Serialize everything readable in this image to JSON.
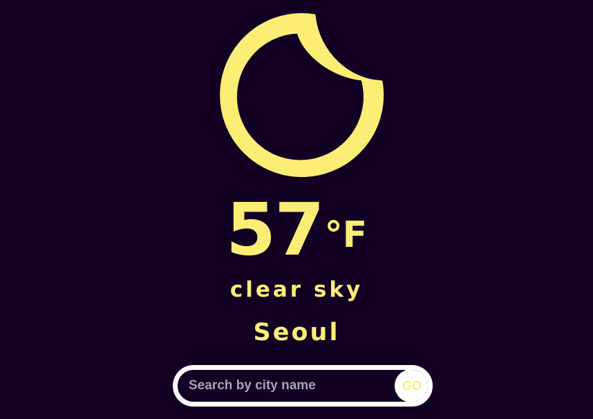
{
  "weather": {
    "icon": "crescent-moon-icon",
    "temperature": "57",
    "unit": "°F",
    "description": "clear sky",
    "city": "Seoul"
  },
  "search": {
    "placeholder": "Search by city name",
    "value": "",
    "button_label": "GO"
  },
  "colors": {
    "background": "#130124",
    "accent": "#fcee74",
    "search_border": "#ffffff"
  }
}
